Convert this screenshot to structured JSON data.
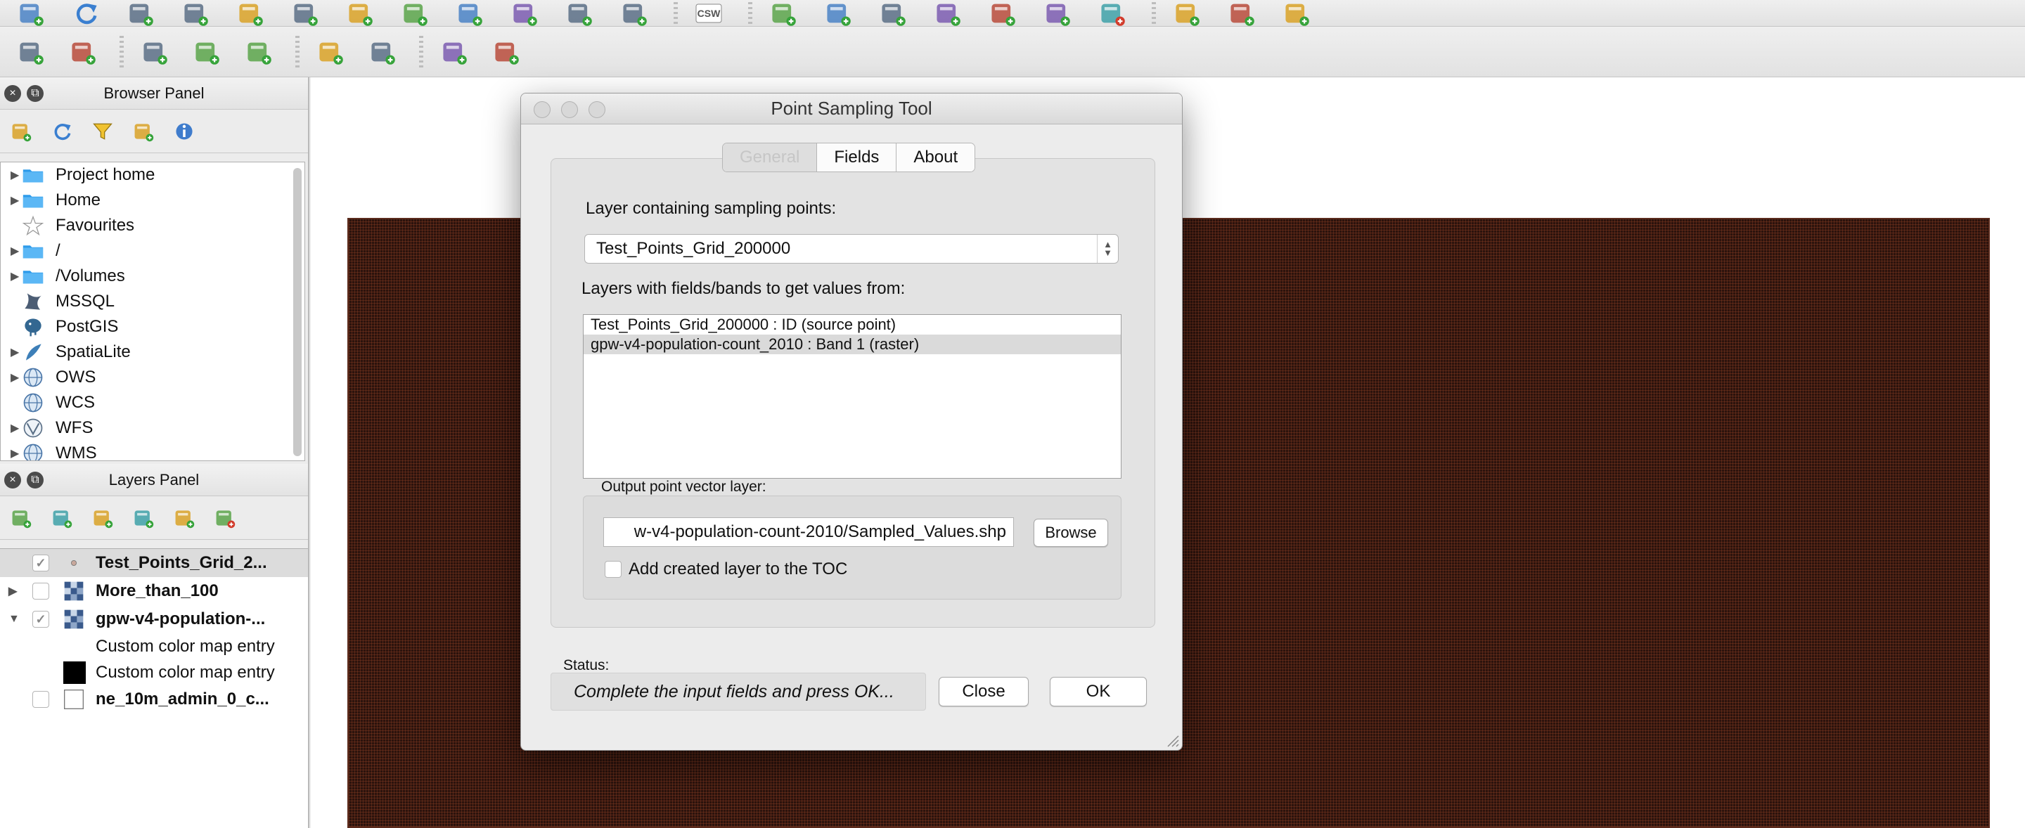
{
  "toolbar_top": {
    "icons": [
      "python-icon",
      "refresh-icon",
      "add-vector-icon",
      "add-raster-icon",
      "add-postgis-icon",
      "add-spatialite-icon",
      "add-mssql-icon",
      "add-wms-icon",
      "add-wcs-icon",
      "add-wfs-icon",
      "add-delimited-icon",
      "new-layer-icon",
      "csw-icon",
      "digitize-icon",
      "edit-pencil-icon",
      "save-edits-icon",
      "add-feature-icon",
      "node-tool-icon",
      "move-feature-icon",
      "delete-selected-icon",
      "cut-features-icon",
      "copy-features-icon",
      "paste-features-icon"
    ],
    "csw_text": "CSW"
  },
  "toolbar_second": {
    "icons": [
      "metasearch-import-icon",
      "metasearch-export-icon",
      "identify-icon",
      "edit-attributes-icon",
      "info-check-icon",
      "layer-settings-icon",
      "tools-icon",
      "network-icon",
      "network-alt-icon"
    ]
  },
  "browser_panel": {
    "title": "Browser Panel",
    "tool_icons": [
      "add-selected-icon",
      "refresh-icon",
      "filter-icon",
      "collapse-all-icon",
      "info-icon"
    ],
    "items": [
      {
        "label": "Project home",
        "icon": "folder-icon",
        "expandable": true
      },
      {
        "label": "Home",
        "icon": "folder-icon",
        "expandable": true
      },
      {
        "label": "Favourites",
        "icon": "star-icon",
        "expandable": false
      },
      {
        "label": "/",
        "icon": "folder-icon",
        "expandable": true
      },
      {
        "label": "/Volumes",
        "icon": "folder-icon",
        "expandable": true
      },
      {
        "label": "MSSQL",
        "icon": "mssql-icon",
        "expandable": false
      },
      {
        "label": "PostGIS",
        "icon": "postgis-icon",
        "expandable": false
      },
      {
        "label": "SpatiaLite",
        "icon": "spatialite-icon",
        "expandable": true
      },
      {
        "label": "OWS",
        "icon": "globe-icon",
        "expandable": true
      },
      {
        "label": "WCS",
        "icon": "globe-icon",
        "expandable": false
      },
      {
        "label": "WFS",
        "icon": "wfs-icon",
        "expandable": true
      },
      {
        "label": "WMS",
        "icon": "globe-icon",
        "expandable": true
      }
    ]
  },
  "layers_panel": {
    "title": "Layers Panel",
    "tool_icons": [
      "add-group-icon",
      "manage-visibility-icon",
      "filter-legend-icon",
      "expand-all-icon",
      "collapse-all-icon",
      "remove-layer-icon"
    ],
    "layers": [
      {
        "name": "Test_Points_Grid_2...",
        "checked": true,
        "selected": true,
        "arrow": "",
        "icon": "point-icon"
      },
      {
        "name": "More_than_100",
        "checked": false,
        "selected": false,
        "arrow": "▶",
        "icon": "raster-icon"
      },
      {
        "name": "gpw-v4-population-...",
        "checked": true,
        "selected": false,
        "arrow": "▼",
        "icon": "raster-icon"
      }
    ],
    "legend_entries": [
      {
        "label": "Custom color map entry",
        "swatch": ""
      },
      {
        "label": "Custom color map entry",
        "swatch": "#000000"
      }
    ],
    "last_layer": {
      "name": "ne_10m_admin_0_c...",
      "checked": false,
      "icon": "polygon-icon"
    }
  },
  "dialog": {
    "title": "Point Sampling Tool",
    "tabs": [
      {
        "label": "General",
        "active": true
      },
      {
        "label": "Fields",
        "active": false
      },
      {
        "label": "About",
        "active": false
      }
    ],
    "sampling_label": "Layer containing sampling points:",
    "sampling_value": "Test_Points_Grid_200000",
    "fields_label": "Layers with fields/bands to get values from:",
    "fields_items": [
      {
        "text": "Test_Points_Grid_200000 : ID (source point)",
        "selected": false
      },
      {
        "text": "gpw-v4-population-count_2010 : Band 1 (raster)",
        "selected": true
      }
    ],
    "output_label": "Output point vector layer:",
    "output_value": "w-v4-population-count-2010/Sampled_Values.shp",
    "browse_label": "Browse",
    "toc_label": "Add created layer to the TOC",
    "toc_checked": false,
    "status_label": "Status:",
    "status_text": "Complete the input fields and press OK...",
    "close_label": "Close",
    "ok_label": "OK"
  },
  "colors": {
    "raster_fill": "#2c130d",
    "raster_grid": "#a04628",
    "folder_blue": "#2d9bea",
    "panel_bg": "#ececec"
  }
}
